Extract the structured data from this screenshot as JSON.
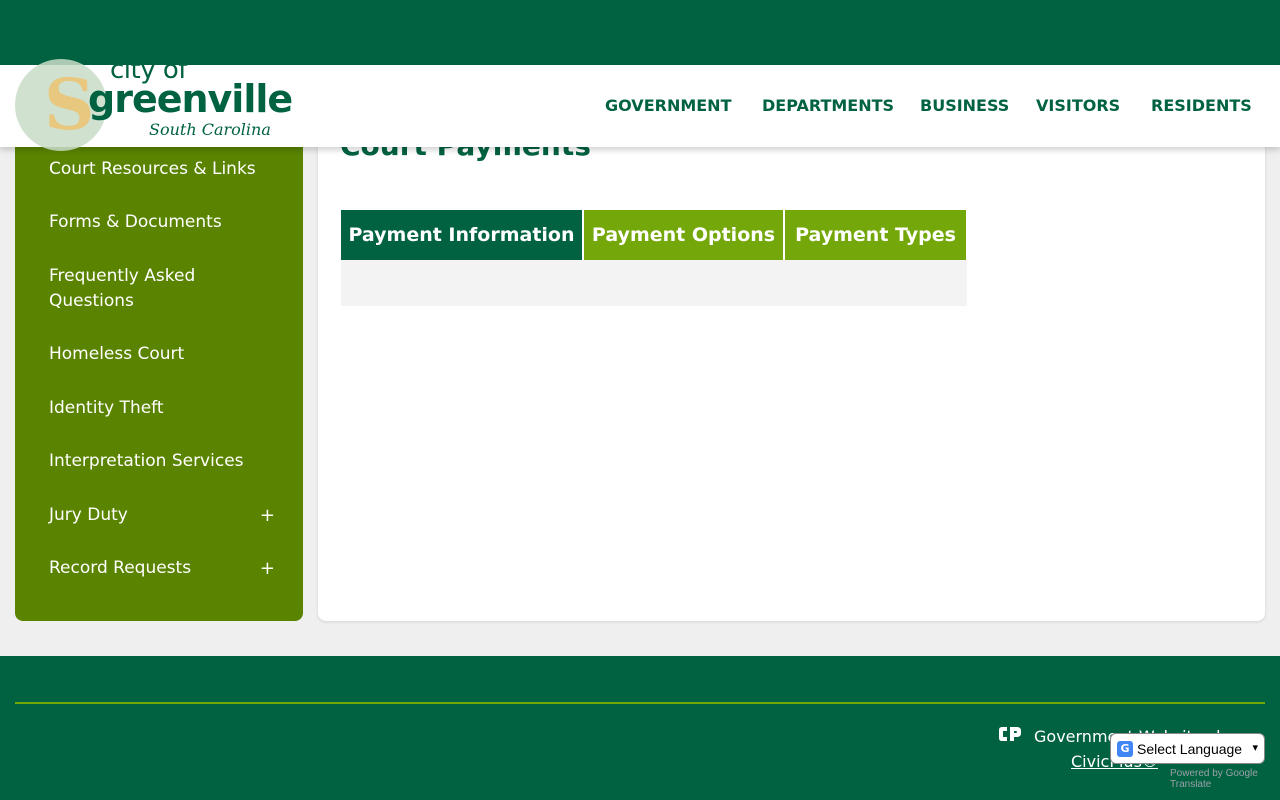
{
  "header": {
    "logo": {
      "city_of": "city of",
      "name": "greenville",
      "state": "South Carolina"
    },
    "nav": [
      {
        "label": "GOVERNMENT"
      },
      {
        "label": "DEPARTMENTS"
      },
      {
        "label": "BUSINESS"
      },
      {
        "label": "VISITORS"
      },
      {
        "label": "RESIDENTS"
      }
    ]
  },
  "sidebar": {
    "items": [
      {
        "label": "Court Resources & Links"
      },
      {
        "label": "Forms & Documents"
      },
      {
        "label": "Frequently Asked Questions"
      },
      {
        "label": "Homeless Court"
      },
      {
        "label": "Identity Theft"
      },
      {
        "label": "Interpretation Services"
      },
      {
        "label": "Jury Duty",
        "expand": "+"
      },
      {
        "label": "Record Requests",
        "expand": "+"
      }
    ]
  },
  "main": {
    "title": "Court Payments",
    "tabs": [
      {
        "label": "Payment Information",
        "active": true
      },
      {
        "label": "Payment Options",
        "active": false
      },
      {
        "label": "Payment Types",
        "active": false
      }
    ]
  },
  "footer": {
    "credit_text": "Government Websites by",
    "credit_link": "CivicPlus®"
  },
  "translate": {
    "label": "Select Language",
    "caret": "▾",
    "powered_by": "Powered by",
    "google": "Google",
    "translate": "Translate"
  },
  "colors": {
    "brand_green": "#006241",
    "sidebar_green": "#5a8400",
    "tab_light_green": "#74a80a"
  },
  "icons": {
    "logo": "city-seal-icon",
    "civicplus": "civicplus-logo-icon",
    "google_g": "google-translate-icon"
  }
}
